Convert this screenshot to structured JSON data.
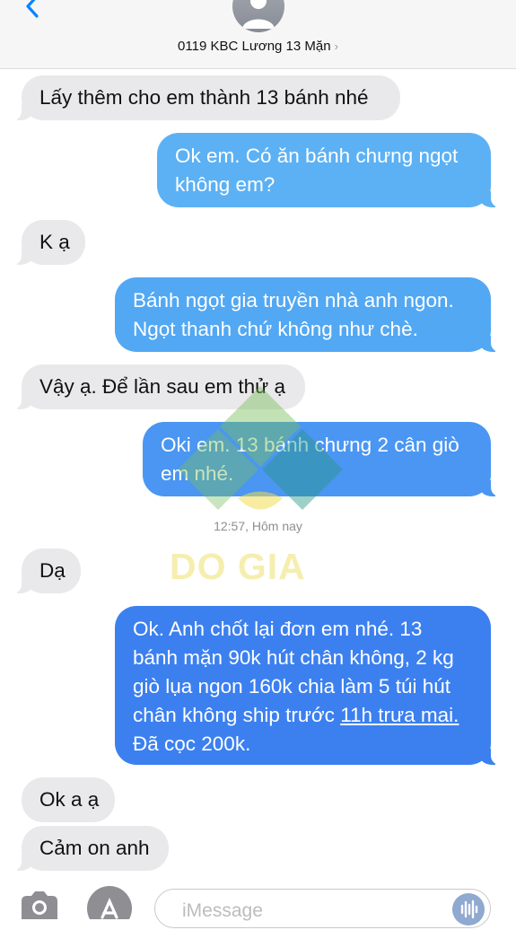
{
  "header": {
    "contact_name": "0119 KBC Lương 13 Mặn",
    "chevron": "›"
  },
  "messages": [
    {
      "from": "in",
      "lines": [
        "Lấy thêm cho em thành 13 bánh nhé"
      ]
    },
    {
      "from": "out",
      "lines": [
        "Ok em. Có ăn bánh chưng ngọt",
        "không em?"
      ]
    },
    {
      "from": "in",
      "lines": [
        "K ạ"
      ]
    },
    {
      "from": "out",
      "lines": [
        "Bánh ngọt gia truyền nhà anh ngon.",
        "Ngọt thanh chứ không như chè."
      ]
    },
    {
      "from": "in",
      "lines": [
        "Vậy ạ. Để lần sau em thử ạ"
      ]
    },
    {
      "from": "out",
      "lines": [
        "Oki em. 13 bánh chưng 2 cân giò",
        "em nhé."
      ]
    },
    {
      "from": "in",
      "lines": [
        "Dạ"
      ]
    },
    {
      "from": "out",
      "lines": [
        "Ok. Anh chốt lại đơn em nhé. 13",
        "bánh mặn 90k hút chân không, 2 kg",
        "giò lụa ngon 160k chia làm 5 túi hút",
        "chân không ship trước ",
        "Đã cọc 200k."
      ],
      "link": "11h trưa mai."
    },
    {
      "from": "in",
      "lines": [
        "Ok a ạ"
      ]
    },
    {
      "from": "in",
      "lines": [
        "Cảm on anh"
      ]
    }
  ],
  "timestamp": "12:57, Hôm nay",
  "watermark": {
    "text": "DO GIA"
  },
  "input": {
    "placeholder": "iMessage"
  },
  "icons": [
    "back-chevron-icon",
    "avatar-icon",
    "camera-icon",
    "app-store-icon",
    "voice-icon"
  ],
  "colors": {
    "incoming_bubble": "#e9e9eb",
    "outgoing_light": "#5fb0f2",
    "outgoing_dark": "#3b7ff0",
    "ios_blue": "#0a84ff"
  }
}
